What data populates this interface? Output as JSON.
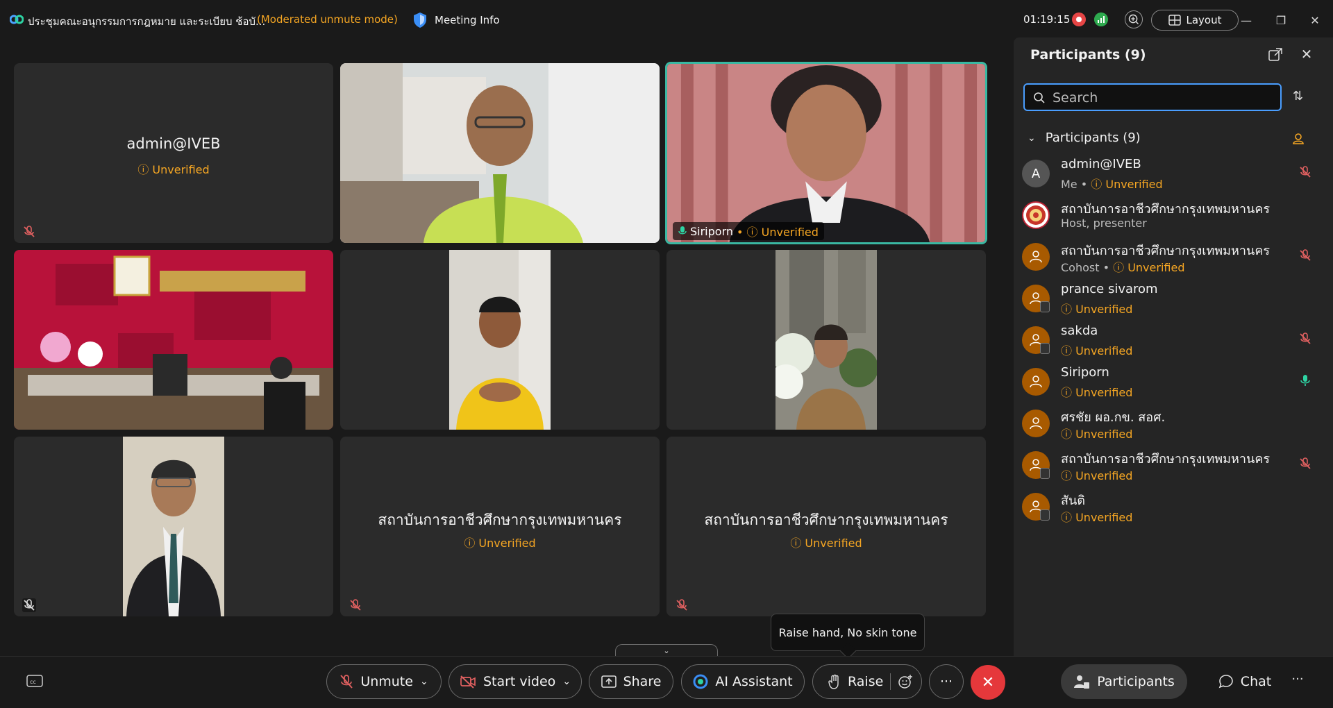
{
  "titlebar": {
    "meeting_title": "ประชุมคณะอนุกรรมการกฎหมาย และระเบียบ ช้อบั...",
    "mode": "(Moderated unmute mode)",
    "meeting_info": "Meeting Info",
    "timer": "01:19:15",
    "layout_label": "Layout"
  },
  "tiles": [
    {
      "name": "admin@IVEB",
      "status": "Unverified"
    },
    {
      "name": "",
      "status": ""
    },
    {
      "name": "Siriporn",
      "status": "Unverified"
    },
    {
      "name": "",
      "status": ""
    },
    {
      "name": "",
      "status": ""
    },
    {
      "name": "",
      "status": ""
    },
    {
      "name": "",
      "status": ""
    },
    {
      "name": "สถาบันการอาชีวศึกษากรุงเทพมหานคร",
      "status": "Unverified"
    },
    {
      "name": "สถาบันการอาชีวศึกษากรุงเทพมหานคร",
      "status": "Unverified"
    }
  ],
  "panel": {
    "title": "Participants (9)",
    "search_placeholder": "Search",
    "group_label": "Participants (9)",
    "participants": [
      {
        "name": "admin@IVEB",
        "role": "Me",
        "status": "Unverified",
        "initial": "A"
      },
      {
        "name": "สถาบันการอาชีวศึกษากรุงเทพมหานคร",
        "role": "Host, presenter",
        "status": ""
      },
      {
        "name": "สถาบันการอาชีวศึกษากรุงเทพมหานคร",
        "role": "Cohost",
        "status": "Unverified"
      },
      {
        "name": "prance sivarom",
        "role": "",
        "status": "Unverified"
      },
      {
        "name": "sakda",
        "role": "",
        "status": "Unverified"
      },
      {
        "name": "Siriporn",
        "role": "",
        "status": "Unverified"
      },
      {
        "name": "ศรชัย ผอ.กข. สอศ.",
        "role": "",
        "status": "Unverified"
      },
      {
        "name": "สถาบันการอาชีวศึกษากรุงเทพมหานคร",
        "role": "",
        "status": "Unverified"
      },
      {
        "name": "สันติ",
        "role": "",
        "status": "Unverified"
      }
    ]
  },
  "controls": {
    "unmute": "Unmute",
    "start_video": "Start video",
    "share": "Share",
    "ai_assistant": "AI Assistant",
    "raise": "Raise",
    "participants": "Participants",
    "chat": "Chat",
    "more": "···"
  },
  "tooltip": {
    "text": "Raise hand, No skin tone"
  },
  "colors": {
    "accent_blue": "#4a9eff",
    "warning": "#f5a623",
    "active_border": "#3ab8a2",
    "end_call": "#e5383b",
    "avatar_orange": "#a85a00"
  }
}
